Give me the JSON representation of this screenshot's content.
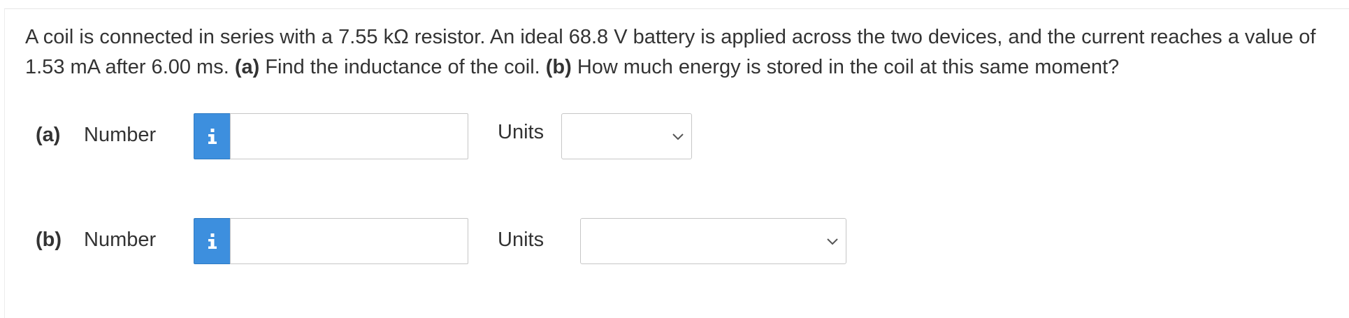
{
  "question": {
    "seg1": "A coil is connected in series with a 7.55 kΩ resistor. An ideal 68.8 V battery is applied across the two devices, and the current reaches a value of 1.53 mA after 6.00 ms. ",
    "part_a_marker": "(a)",
    "seg2": " Find the inductance of the coil. ",
    "part_b_marker": "(b)",
    "seg3": " How much energy is stored in the coil at this same moment?"
  },
  "part_a": {
    "label": "(a)",
    "number_label": "Number",
    "info_icon": "info-icon",
    "number_value": "",
    "units_label": "Units",
    "units_selected": ""
  },
  "part_b": {
    "label": "(b)",
    "number_label": "Number",
    "info_icon": "info-icon",
    "number_value": "",
    "units_label": "Units",
    "units_selected": ""
  },
  "colors": {
    "info_button": "#3d8fde",
    "text": "#333333",
    "border": "#c6c6c6"
  }
}
